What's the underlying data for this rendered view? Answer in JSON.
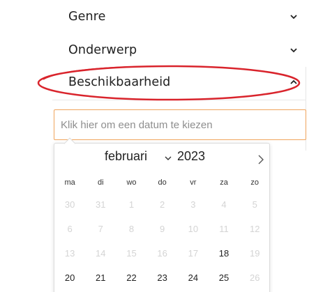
{
  "filters": {
    "genre": {
      "label": "Genre",
      "expanded": false,
      "icon": "chevron-down-icon"
    },
    "onderwerp": {
      "label": "Onderwerp",
      "expanded": false,
      "icon": "chevron-down-icon"
    },
    "beschikbaarheid": {
      "label": "Beschikbaarheid",
      "expanded": true,
      "icon": "chevron-up-icon"
    }
  },
  "highlight_color": "#d9242c",
  "accent_color": "#f0a45c",
  "date_input": {
    "placeholder": "Klik hier om een datum te kiezen",
    "value": ""
  },
  "calendar": {
    "month": "februari",
    "year": "2023",
    "weekdays": [
      "ma",
      "di",
      "wo",
      "do",
      "vr",
      "za",
      "zo"
    ],
    "weeks": [
      [
        {
          "d": "30",
          "a": false
        },
        {
          "d": "31",
          "a": false
        },
        {
          "d": "1",
          "a": false
        },
        {
          "d": "2",
          "a": false
        },
        {
          "d": "3",
          "a": false
        },
        {
          "d": "4",
          "a": false
        },
        {
          "d": "5",
          "a": false
        }
      ],
      [
        {
          "d": "6",
          "a": false
        },
        {
          "d": "7",
          "a": false
        },
        {
          "d": "8",
          "a": false
        },
        {
          "d": "9",
          "a": false
        },
        {
          "d": "10",
          "a": false
        },
        {
          "d": "11",
          "a": false
        },
        {
          "d": "12",
          "a": false
        }
      ],
      [
        {
          "d": "13",
          "a": false
        },
        {
          "d": "14",
          "a": false
        },
        {
          "d": "15",
          "a": false
        },
        {
          "d": "16",
          "a": false
        },
        {
          "d": "17",
          "a": false
        },
        {
          "d": "18",
          "a": true
        },
        {
          "d": "19",
          "a": false
        }
      ],
      [
        {
          "d": "20",
          "a": true
        },
        {
          "d": "21",
          "a": true
        },
        {
          "d": "22",
          "a": true
        },
        {
          "d": "23",
          "a": true
        },
        {
          "d": "24",
          "a": true
        },
        {
          "d": "25",
          "a": true
        },
        {
          "d": "26",
          "a": false
        }
      ]
    ]
  }
}
